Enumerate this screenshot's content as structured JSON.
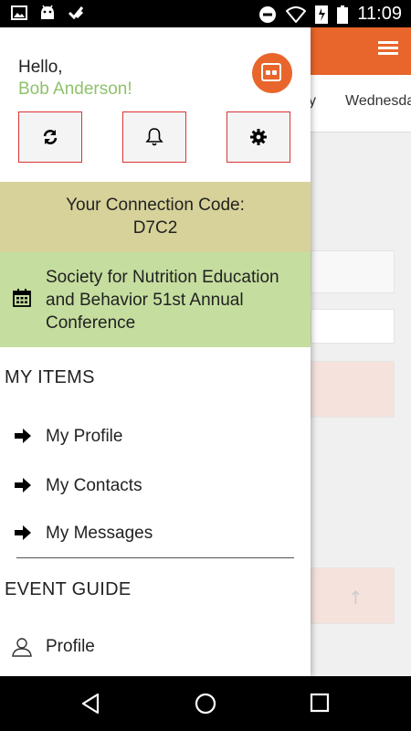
{
  "status_bar": {
    "time": "11:09",
    "left_icons": [
      "image-icon",
      "android-icon",
      "checkmark-icon"
    ],
    "right_icons": [
      "dnd-icon",
      "wifi-icon",
      "data-icon",
      "battery-icon"
    ]
  },
  "background_app": {
    "tabs": [
      "y",
      "Wednesda"
    ],
    "accent": "#e8662b"
  },
  "drawer": {
    "greeting": "Hello,",
    "user_name": "Bob Anderson!",
    "actions": [
      "refresh",
      "notifications",
      "settings"
    ],
    "connection_code_label": "Your Connection Code:",
    "connection_code": "D7C2",
    "event_name": "Society for Nutrition Education and Behavior 51st Annual Conference",
    "my_items_heading": "MY ITEMS",
    "my_items": [
      {
        "label": "My Profile"
      },
      {
        "label": "My Contacts"
      },
      {
        "label": "My Messages"
      }
    ],
    "event_guide_heading": "EVENT GUIDE",
    "event_guide_items": [
      {
        "label": "Profile"
      }
    ]
  },
  "colors": {
    "connection_bg": "#d7d29a",
    "event_bg": "#c5de9f",
    "name_green": "#8fc26b",
    "button_border": "#dd3333"
  }
}
